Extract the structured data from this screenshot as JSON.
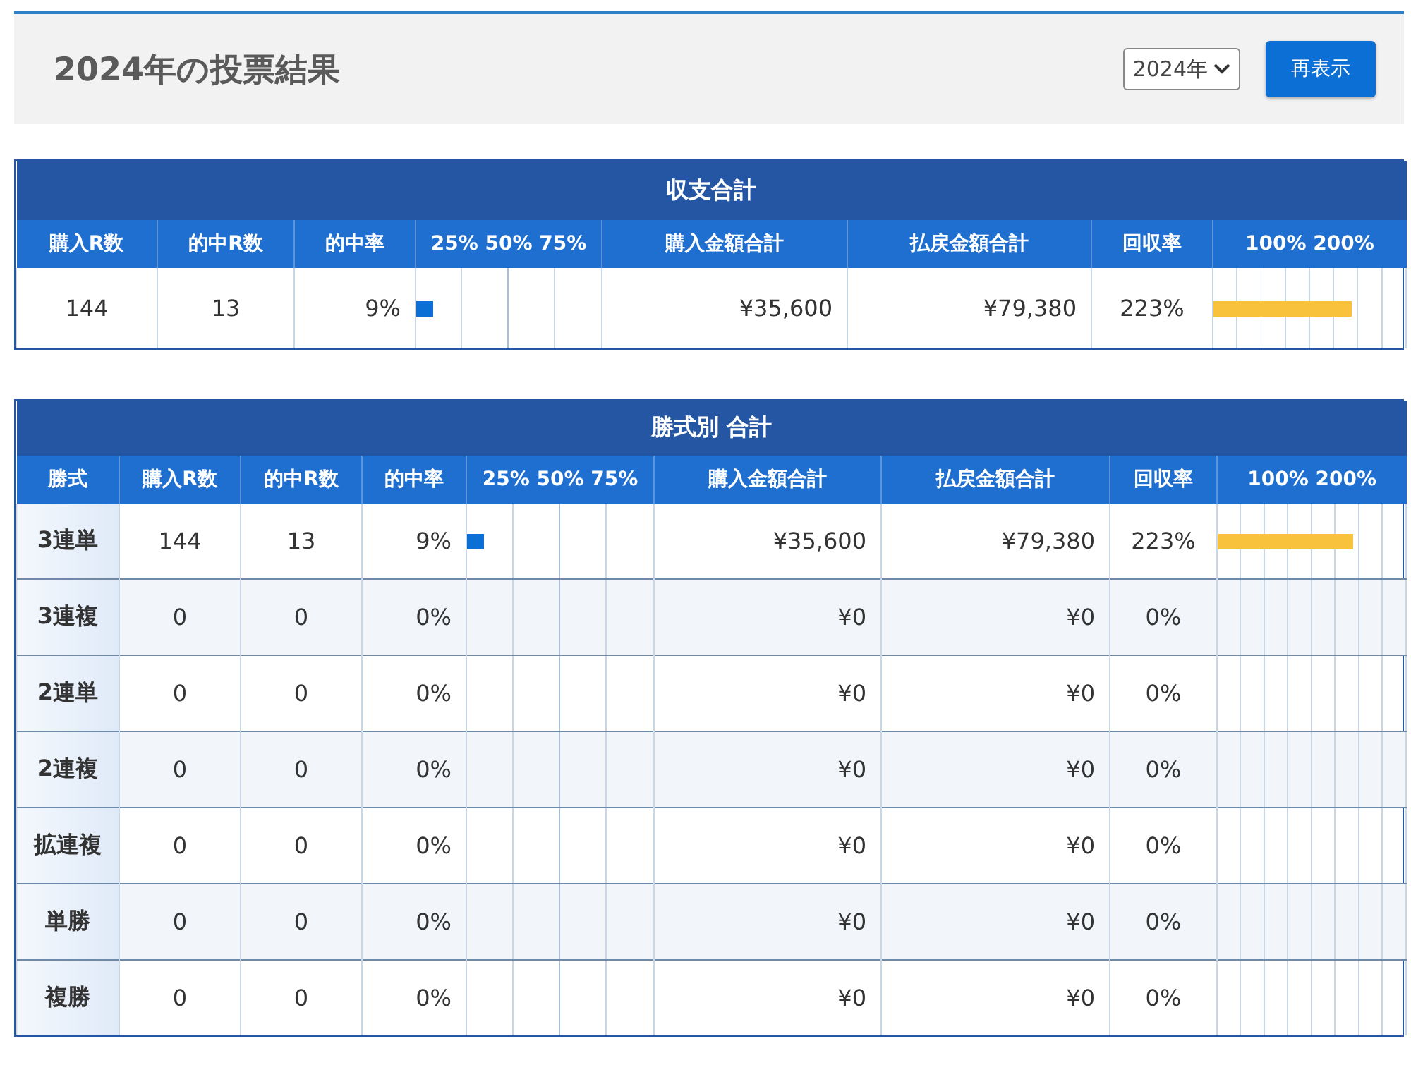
{
  "header": {
    "title": "2024年の投票結果",
    "year_select": "2024年",
    "refresh_button": "再表示"
  },
  "summary": {
    "title": "収支合計",
    "columns": [
      "購入R数",
      "的中R数",
      "的中率",
      "25% 50% 75%",
      "購入金額合計",
      "払戻金額合計",
      "回収率",
      "100% 200%"
    ],
    "rows": [
      {
        "purchased": "144",
        "hits": "13",
        "hit_rate": "9%",
        "hit_bar": {
          "level": 0.09
        },
        "spent": "¥35,600",
        "payout": "¥79,380",
        "recovery": "223%",
        "recovery_bar": {
          "level": 0.72
        }
      }
    ]
  },
  "by_type": {
    "title": "勝式別 合計",
    "columns": [
      "勝式",
      "購入R数",
      "的中R数",
      "的中率",
      "25% 50% 75%",
      "購入金額合計",
      "払戻金額合計",
      "回収率",
      "100% 200%"
    ],
    "rows": [
      {
        "type": "3連単",
        "purchased": "144",
        "hits": "13",
        "hit_rate": "9%",
        "hit_bar": {
          "level": 0.09
        },
        "spent": "¥35,600",
        "payout": "¥79,380",
        "recovery": "223%",
        "recovery_bar": {
          "level": 0.72
        }
      },
      {
        "type": "3連複",
        "purchased": "0",
        "hits": "0",
        "hit_rate": "0%",
        "spent": "¥0",
        "payout": "¥0",
        "recovery": "0%"
      },
      {
        "type": "2連単",
        "purchased": "0",
        "hits": "0",
        "hit_rate": "0%",
        "spent": "¥0",
        "payout": "¥0",
        "recovery": "0%"
      },
      {
        "type": "2連複",
        "purchased": "0",
        "hits": "0",
        "hit_rate": "0%",
        "spent": "¥0",
        "payout": "¥0",
        "recovery": "0%"
      },
      {
        "type": "拡連複",
        "purchased": "0",
        "hits": "0",
        "hit_rate": "0%",
        "spent": "¥0",
        "payout": "¥0",
        "recovery": "0%"
      },
      {
        "type": "単勝",
        "purchased": "0",
        "hits": "0",
        "hit_rate": "0%",
        "spent": "¥0",
        "payout": "¥0",
        "recovery": "0%"
      },
      {
        "type": "複勝",
        "purchased": "0",
        "hits": "0",
        "hit_rate": "0%",
        "spent": "¥0",
        "payout": "¥0",
        "recovery": "0%"
      }
    ]
  }
}
